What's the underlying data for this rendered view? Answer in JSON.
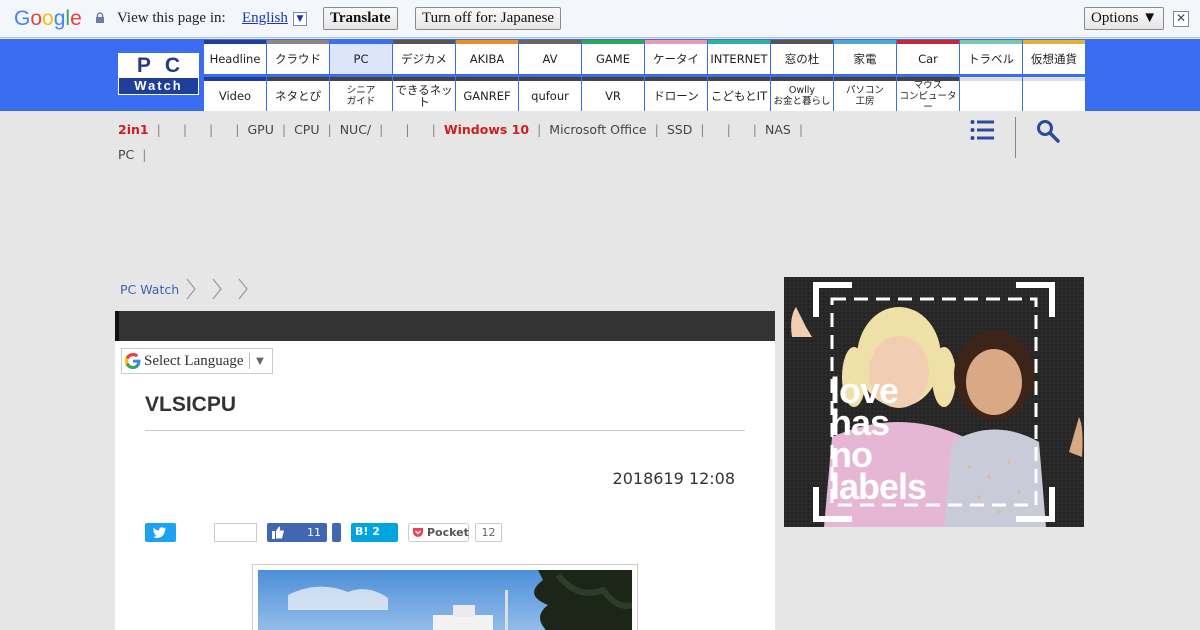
{
  "translate_bar": {
    "logo_text": "Google",
    "view_text": "View this page in:",
    "language": "English",
    "translate_label": "Translate",
    "turn_off_label": "Turn off for: Japanese",
    "options_label": "Options ▼",
    "close_glyph": "✕"
  },
  "site": {
    "logo_top": "PC",
    "logo_bottom": "Watch"
  },
  "nav": {
    "row1": [
      "Headline",
      "クラウド",
      "PC",
      "デジカメ",
      "AKIBA",
      "AV",
      "GAME",
      "ケータイ",
      "INTERNET",
      "窓の杜",
      "家電",
      "Car",
      "トラベル",
      "仮想通貨"
    ],
    "row2": [
      "Video",
      "ネタとぴ",
      "シニア\nガイド",
      "できるネット",
      "GANREF",
      "qufour",
      "VR",
      "ドローン",
      "こどもとIT",
      "Owlly\nお金と暮らし",
      "パソコン\n工房",
      "マウス\nコンピューター"
    ],
    "active": "PC",
    "row1_colors": [
      "#1e3e99",
      "#888888",
      "#3a6df0",
      "#555555",
      "#e88f2b",
      "#666666",
      "#29a85c",
      "#e49ab8",
      "#2bb4a0",
      "#555555",
      "#4fa7d9",
      "#c0283b",
      "#76c8b0",
      "#e2b23c"
    ],
    "row2_colors": [
      "#1e3e99",
      "#444444",
      "#444444",
      "#444444",
      "#444444",
      "#444444",
      "#444444",
      "#444444",
      "#444444",
      "#444444",
      "#444444",
      "#444444"
    ]
  },
  "categories": {
    "items": [
      "2in1",
      "",
      "",
      "",
      "GPU",
      "CPU",
      "NUC/",
      "",
      "",
      "Windows 10",
      "Microsoft Office",
      "SSD",
      "",
      "",
      "NAS",
      "PC"
    ],
    "highlight": [
      "2in1",
      "Windows 10"
    ]
  },
  "breadcrumb": {
    "home": "PC Watch"
  },
  "article": {
    "language_select": "Select Language",
    "title": "VLSICPU",
    "date": "2018619 12:08",
    "fb_count": "11",
    "hatena_label": "B! 2",
    "pocket_label": "Pocket",
    "pocket_count": "12"
  },
  "ad": {
    "text_lines": [
      "love",
      "has",
      "no",
      "labels"
    ]
  },
  "colors": {
    "header_blue": "#3a6df0",
    "highlight_red": "#cc1f1f",
    "twitter": "#1da1f2",
    "facebook": "#4267b2",
    "hatena": "#00a4de"
  }
}
